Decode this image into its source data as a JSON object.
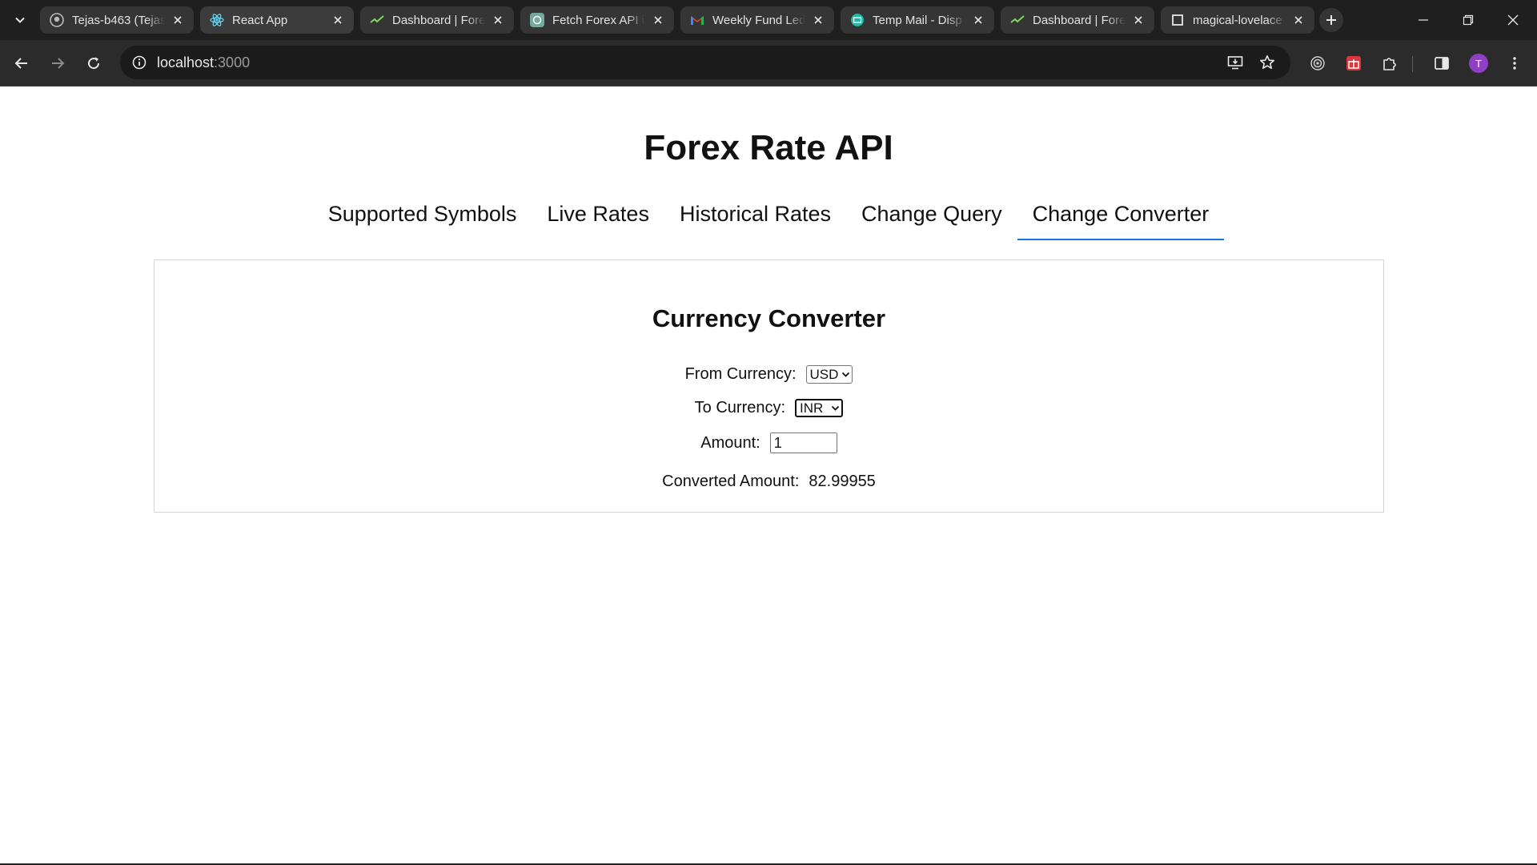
{
  "browser": {
    "tabs": [
      {
        "title": "Tejas-b463 (Tejas",
        "icon": "github-icon"
      },
      {
        "title": "React App",
        "icon": "react-icon",
        "active": true
      },
      {
        "title": "Dashboard | Fore",
        "icon": "dashboard-check-icon"
      },
      {
        "title": "Fetch Forex API i",
        "icon": "chatgpt-icon"
      },
      {
        "title": "Weekly Fund Led",
        "icon": "gmail-icon"
      },
      {
        "title": "Temp Mail - Disp",
        "icon": "tempmail-icon"
      },
      {
        "title": "Dashboard | Fore",
        "icon": "dashboard-check-icon"
      },
      {
        "title": "magical-lovelace",
        "icon": "codesandbox-icon"
      }
    ],
    "url_host": "localhost",
    "url_port": ":3000",
    "profile_initial": "T"
  },
  "page": {
    "title": "Forex Rate API",
    "nav": [
      {
        "label": "Supported Symbols"
      },
      {
        "label": "Live Rates"
      },
      {
        "label": "Historical Rates"
      },
      {
        "label": "Change Query"
      },
      {
        "label": "Change Converter",
        "active": true
      }
    ],
    "converter": {
      "heading": "Currency Converter",
      "from_label": "From Currency:",
      "from_value": "USD",
      "to_label": "To Currency:",
      "to_value": "INR",
      "amount_label": "Amount:",
      "amount_value": "1",
      "result_label": "Converted Amount:",
      "result_value": "82.99955"
    }
  },
  "colors": {
    "accent": "#1a73e8",
    "chrome_dark": "#1f1f1f",
    "profile": "#8e3fc4"
  }
}
